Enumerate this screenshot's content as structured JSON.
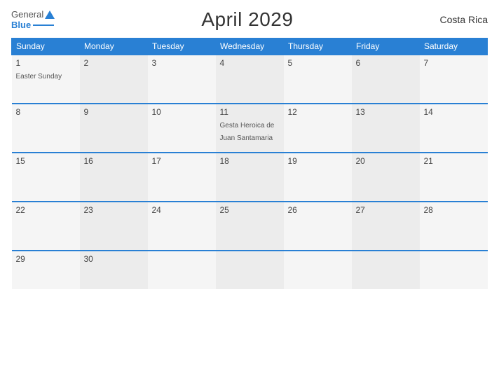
{
  "header": {
    "title": "April 2029",
    "country": "Costa Rica",
    "logo_general": "General",
    "logo_blue": "Blue"
  },
  "days_of_week": [
    "Sunday",
    "Monday",
    "Tuesday",
    "Wednesday",
    "Thursday",
    "Friday",
    "Saturday"
  ],
  "weeks": [
    [
      {
        "day": "1",
        "event": "Easter Sunday"
      },
      {
        "day": "2",
        "event": ""
      },
      {
        "day": "3",
        "event": ""
      },
      {
        "day": "4",
        "event": ""
      },
      {
        "day": "5",
        "event": ""
      },
      {
        "day": "6",
        "event": ""
      },
      {
        "day": "7",
        "event": ""
      }
    ],
    [
      {
        "day": "8",
        "event": ""
      },
      {
        "day": "9",
        "event": ""
      },
      {
        "day": "10",
        "event": ""
      },
      {
        "day": "11",
        "event": "Gesta Heroica de Juan Santamaria"
      },
      {
        "day": "12",
        "event": ""
      },
      {
        "day": "13",
        "event": ""
      },
      {
        "day": "14",
        "event": ""
      }
    ],
    [
      {
        "day": "15",
        "event": ""
      },
      {
        "day": "16",
        "event": ""
      },
      {
        "day": "17",
        "event": ""
      },
      {
        "day": "18",
        "event": ""
      },
      {
        "day": "19",
        "event": ""
      },
      {
        "day": "20",
        "event": ""
      },
      {
        "day": "21",
        "event": ""
      }
    ],
    [
      {
        "day": "22",
        "event": ""
      },
      {
        "day": "23",
        "event": ""
      },
      {
        "day": "24",
        "event": ""
      },
      {
        "day": "25",
        "event": ""
      },
      {
        "day": "26",
        "event": ""
      },
      {
        "day": "27",
        "event": ""
      },
      {
        "day": "28",
        "event": ""
      }
    ],
    [
      {
        "day": "29",
        "event": ""
      },
      {
        "day": "30",
        "event": ""
      },
      {
        "day": "",
        "event": ""
      },
      {
        "day": "",
        "event": ""
      },
      {
        "day": "",
        "event": ""
      },
      {
        "day": "",
        "event": ""
      },
      {
        "day": "",
        "event": ""
      }
    ]
  ],
  "colors": {
    "header_bg": "#2980d4",
    "accent": "#2980d4"
  }
}
